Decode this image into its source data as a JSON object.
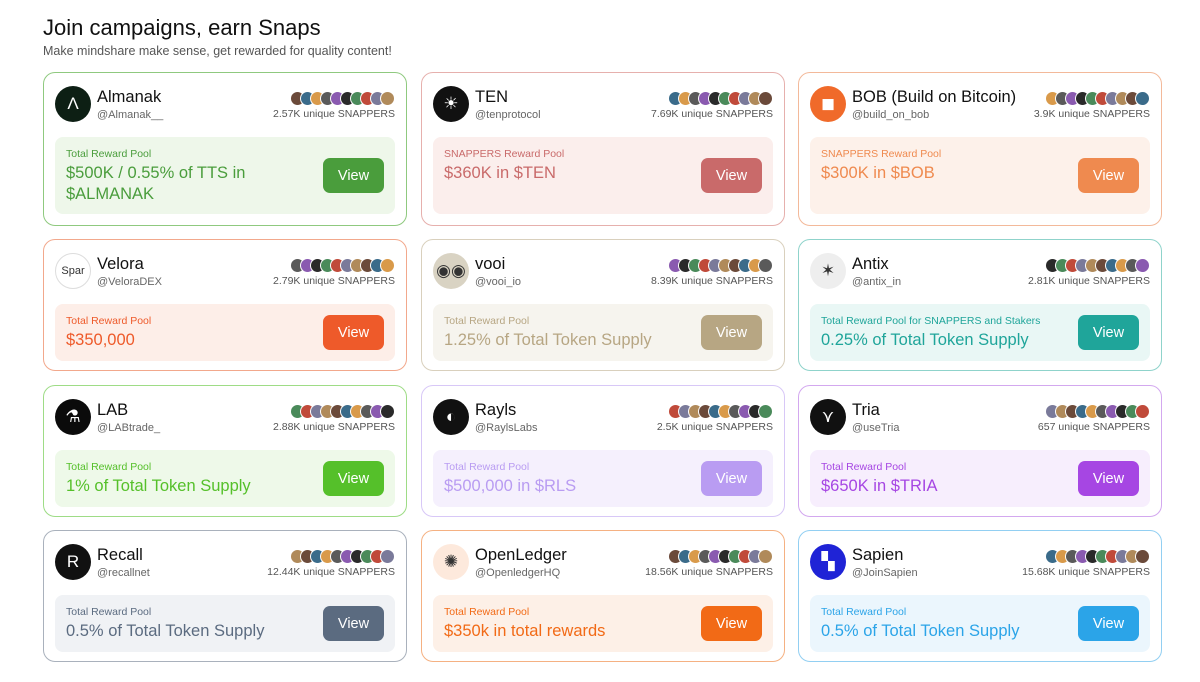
{
  "header": {
    "title": "Join campaigns, earn Snaps",
    "subtitle": "Make mindshare make sense, get rewarded for quality content!"
  },
  "view_label": "View",
  "cards": [
    {
      "name": "Almanak",
      "handle": "@Almanak__",
      "snappers": "2.57K unique SNAPPERS",
      "pool_label": "Total Reward Pool",
      "pool_value": "$500K / 0.55% of TTS in $ALMANAK",
      "accent": "#4a9d3c",
      "border": "#8fc97f",
      "pool_bg": "#eef7ea",
      "avatar_bg": "#0d1f14",
      "avatar_glyph": "Λ",
      "avatar_icon": "almanak-logo-icon"
    },
    {
      "name": "TEN",
      "handle": "@tenprotocol",
      "snappers": "7.69K unique SNAPPERS",
      "pool_label": "SNAPPERS Reward Pool",
      "pool_value": "$360K in $TEN",
      "accent": "#c96a6a",
      "border": "#e6b0ad",
      "pool_bg": "#fbeeec",
      "avatar_bg": "#111111",
      "avatar_glyph": "☀",
      "avatar_icon": "ten-logo-icon"
    },
    {
      "name": "BOB (Build on Bitcoin)",
      "handle": "@build_on_bob",
      "snappers": "3.9K unique SNAPPERS",
      "pool_label": "SNAPPERS Reward Pool",
      "pool_value": "$300K in $BOB",
      "accent": "#ef8a4f",
      "border": "#f3b99a",
      "pool_bg": "#fdf1ea",
      "avatar_bg": "#f06a2a",
      "avatar_glyph": "◼",
      "avatar_icon": "bob-logo-icon"
    },
    {
      "name": "Velora",
      "handle": "@VeloraDEX",
      "snappers": "2.79K unique SNAPPERS",
      "pool_label": "Total Reward Pool",
      "pool_value": "$350,000",
      "accent": "#ee5a2a",
      "border": "#f2a88c",
      "pool_bg": "#fdeee8",
      "avatar_bg": "#ffffff",
      "avatar_glyph": "Spar",
      "avatar_icon": "velora-logo-icon"
    },
    {
      "name": "vooi",
      "handle": "@vooi_io",
      "snappers": "8.39K unique SNAPPERS",
      "pool_label": "Total Reward Pool",
      "pool_value": "1.25% of Total Token Supply",
      "accent": "#b7a683",
      "border": "#d9d0bd",
      "pool_bg": "#f6f4ee",
      "avatar_bg": "#d9d3c3",
      "avatar_glyph": "◉◉",
      "avatar_icon": "vooi-logo-icon"
    },
    {
      "name": "Antix",
      "handle": "@antix_in",
      "snappers": "2.81K unique SNAPPERS",
      "pool_label": "Total Reward Pool for SNAPPERS and Stakers",
      "pool_value": "0.25% of Total Token Supply",
      "accent": "#1fa59a",
      "border": "#8fd3cb",
      "pool_bg": "#e9f7f5",
      "avatar_bg": "#eeeeee",
      "avatar_glyph": "✶",
      "avatar_icon": "antix-logo-icon"
    },
    {
      "name": "LAB",
      "handle": "@LABtrade_",
      "snappers": "2.88K unique SNAPPERS",
      "pool_label": "Total Reward Pool",
      "pool_value": "1% of Total Token Supply",
      "accent": "#55c02a",
      "border": "#9edc86",
      "pool_bg": "#eef9e9",
      "avatar_bg": "#0b0b0b",
      "avatar_glyph": "⚗",
      "avatar_icon": "lab-logo-icon"
    },
    {
      "name": "Rayls",
      "handle": "@RaylsLabs",
      "snappers": "2.5K unique SNAPPERS",
      "pool_label": "Total Reward Pool",
      "pool_value": "$500,000 in $RLS",
      "accent": "#b99cf2",
      "border": "#d8c8f7",
      "pool_bg": "#f5f0fd",
      "avatar_bg": "#111111",
      "avatar_glyph": "◐",
      "avatar_icon": "rayls-logo-icon"
    },
    {
      "name": "Tria",
      "handle": "@useTria",
      "snappers": "657 unique SNAPPERS",
      "pool_label": "Total Reward Pool",
      "pool_value": "$650K in $TRIA",
      "accent": "#a646e3",
      "border": "#d3a8ef",
      "pool_bg": "#f7eefd",
      "avatar_bg": "#111111",
      "avatar_glyph": "⋎",
      "avatar_icon": "tria-logo-icon"
    },
    {
      "name": "Recall",
      "handle": "@recallnet",
      "snappers": "12.44K unique SNAPPERS",
      "pool_label": "Total Reward Pool",
      "pool_value": "0.5% of Total Token Supply",
      "accent": "#5b6b80",
      "border": "#a9b1bc",
      "pool_bg": "#f0f2f5",
      "avatar_bg": "#111111",
      "avatar_glyph": "R",
      "avatar_icon": "recall-logo-icon"
    },
    {
      "name": "OpenLedger",
      "handle": "@OpenledgerHQ",
      "snappers": "18.56K unique SNAPPERS",
      "pool_label": "Total Reward Pool",
      "pool_value": "$350k in total rewards",
      "accent": "#f26a16",
      "border": "#f5b182",
      "pool_bg": "#fdf0e7",
      "avatar_bg": "#fde9dc",
      "avatar_glyph": "✺",
      "avatar_icon": "openledger-logo-icon"
    },
    {
      "name": "Sapien",
      "handle": "@JoinSapien",
      "snappers": "15.68K unique SNAPPERS",
      "pool_label": "Total Reward Pool",
      "pool_value": "0.5% of Total Token Supply",
      "accent": "#2ba4e8",
      "border": "#92cff2",
      "pool_bg": "#ebf6fd",
      "avatar_bg": "#1f23d6",
      "avatar_glyph": "▚",
      "avatar_icon": "sapien-logo-icon"
    }
  ],
  "mini_avatar_colors": [
    "#6b4a3a",
    "#3a6b8a",
    "#d99a4a",
    "#5a5a5a",
    "#8a5ab0",
    "#2a2a2a",
    "#4a8a5a",
    "#c04a3a",
    "#7a7a9a",
    "#b08a5a"
  ]
}
